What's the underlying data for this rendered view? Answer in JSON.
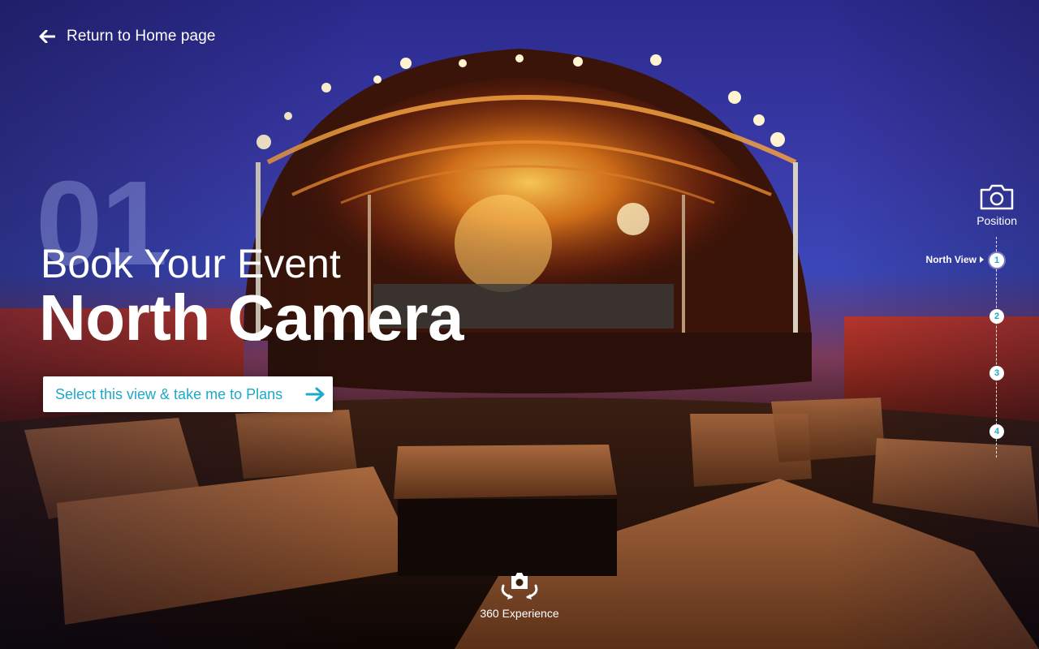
{
  "nav": {
    "back_label": "Return to Home page"
  },
  "hero": {
    "number": "01",
    "kicker": "Book Your Event",
    "title": "North Camera",
    "cta_label": "Select this view & take me to Plans"
  },
  "position": {
    "label": "Position",
    "active_stop_label": "North View",
    "stops": [
      "1",
      "2",
      "3",
      "4"
    ]
  },
  "experience": {
    "label": "360 Experience"
  },
  "colors": {
    "accent": "#1fa8c9",
    "text": "#ffffff",
    "sky": "#3a3aa8",
    "stage_glow": "#ff9a2a"
  },
  "icons": {
    "back": "arrow-left-icon",
    "cta": "arrow-right-icon",
    "position": "camera-icon",
    "experience": "camera-360-icon"
  }
}
